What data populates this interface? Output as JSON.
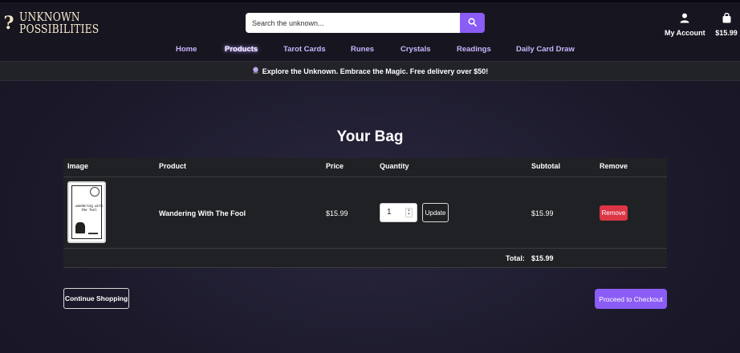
{
  "brand": {
    "line1": "UNKNOWN",
    "line2": "POSSIBILITIES",
    "mark": "?"
  },
  "search": {
    "placeholder": "Search the unknown...",
    "button_icon": "search-icon"
  },
  "account": {
    "label": "My Account",
    "icon": "user-icon"
  },
  "cart": {
    "total": "$15.99",
    "icon": "shopping-bag-icon"
  },
  "nav": {
    "items": [
      {
        "label": "Home"
      },
      {
        "label": "Products",
        "active": true
      },
      {
        "label": "Tarot Cards"
      },
      {
        "label": "Runes"
      },
      {
        "label": "Crystals"
      },
      {
        "label": "Readings"
      },
      {
        "label": "Daily Card Draw"
      }
    ]
  },
  "banner": {
    "icon": "crystal-ball-icon",
    "text": "Explore the Unknown. Embrace the Magic. Free delivery over $50!"
  },
  "page": {
    "title": "Your Bag"
  },
  "table": {
    "headers": {
      "image": "Image",
      "product": "Product",
      "price": "Price",
      "quantity": "Quantity",
      "subtotal": "Subtotal",
      "remove": "Remove"
    },
    "rows": [
      {
        "product": "Wandering With The Fool",
        "price": "$15.99",
        "quantity": "1",
        "subtotal": "$15.99",
        "update_label": "Update",
        "remove_label": "Remove",
        "thumb_text": "wandering with the fool"
      }
    ],
    "total_label": "Total:",
    "total_value": "$15.99"
  },
  "actions": {
    "continue_label": "Continue Shopping",
    "checkout_label": "Proceed to Checkout"
  },
  "colors": {
    "accent": "#8b5cf6",
    "danger": "#dc3545",
    "nav": "#c9b6ff",
    "background": "#1c1a2b"
  }
}
